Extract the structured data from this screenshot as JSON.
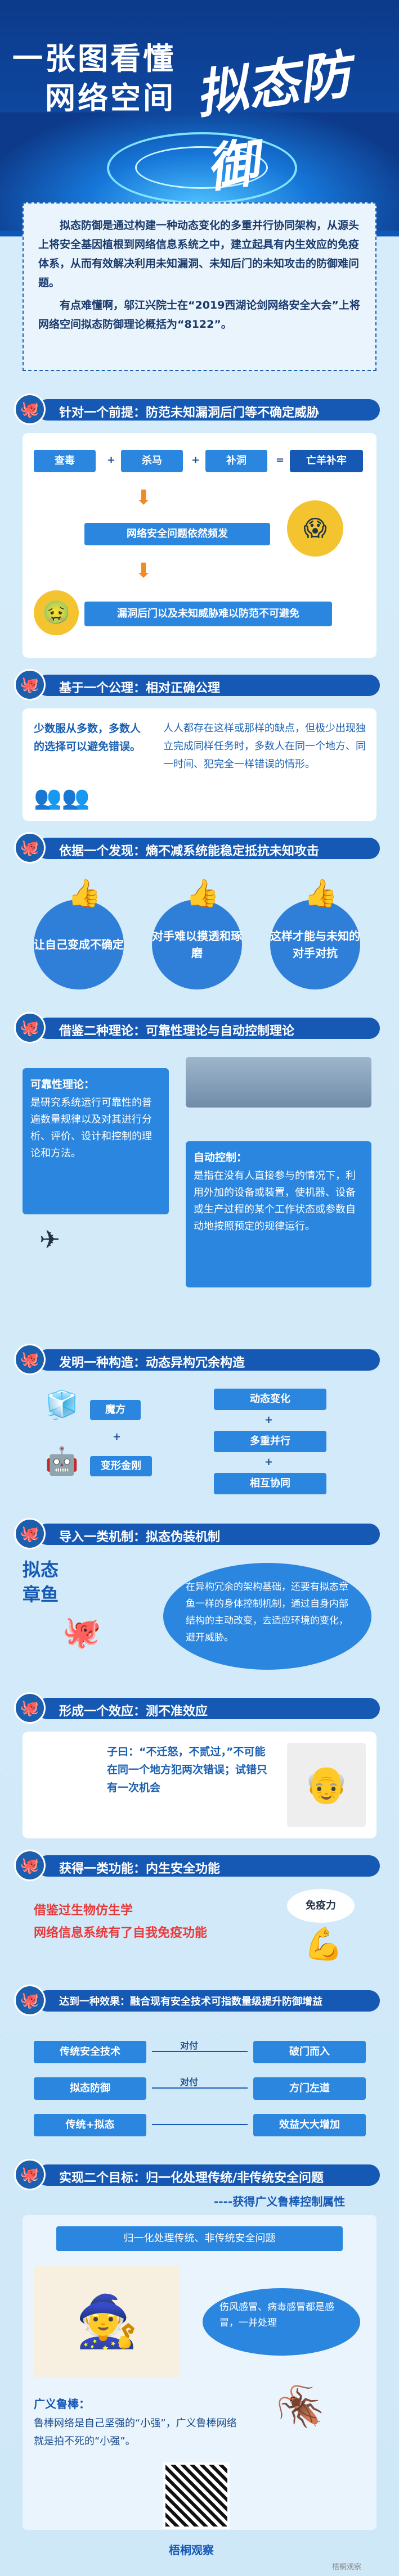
{
  "header": {
    "line1": "一张图看懂",
    "line2": "网络空间",
    "calligraphy": "拟态防御"
  },
  "intro": {
    "p1": "拟态防御是通过构建一种动态变化的多重并行协同架构，从源头上将安全基因植根到网络信息系统之中，建立起具有内生效应的免疫体系，从而有效解决利用未知漏洞、未知后门的未知攻击的防御难问题。",
    "p2": "有点难懂啊，邬江兴院士在“2019西湖论剑网络安全大会”上将网络空间拟态防御理论概括为“8122”。"
  },
  "sections": [
    {
      "title": "针对一个前提：防范未知漏洞后门等不确定威胁"
    },
    {
      "title": "基于一个公理：相对正确公理"
    },
    {
      "title": "依据一个发现：熵不减系统能稳定抵抗未知攻击"
    },
    {
      "title": "借鉴二种理论：可靠性理论与自动控制理论"
    },
    {
      "title": "发明一种构造：动态异构冗余构造"
    },
    {
      "title": "导入一类机制：拟态伪装机制"
    },
    {
      "title": "形成一个效应：测不准效应"
    },
    {
      "title": "获得一类功能：内生安全功能"
    },
    {
      "title": "达到一种效果：融合现有安全技术可指数量级提升防御增益"
    },
    {
      "title": "实现二个目标：归一化处理传统/非传统安全问题"
    }
  ],
  "s1": {
    "a": "查毒",
    "b": "杀马",
    "c": "补洞",
    "result": "亡羊补牢",
    "mid": "网络安全问题依然频发",
    "bottom": "漏洞后门以及未知威胁难以防范不可避免"
  },
  "s2": {
    "left": "少数服从多数，多数人的选择可以避免错误。",
    "right": "人人都存在这样或那样的缺点，但极少出现独立完成同样任务时，多数人在同一个地方、同一时间、犯完全一样错误的情形。"
  },
  "s3": {
    "b1": "让自己变成不确定",
    "b2": "对手难以摸透和琢磨",
    "b3": "这样才能与未知的对手对抗"
  },
  "s4": {
    "rel_title": "可靠性理论：",
    "rel_text": "是研究系统运行可靠性的普遍数量规律以及对其进行分析、评价、设计和控制的理论和方法。",
    "ctl_title": "自动控制：",
    "ctl_text": "是指在没有人直接参与的情况下，利用外加的设备或装置，使机器、设备或生产过程的某个工作状态或参数自动地按照预定的规律运行。"
  },
  "s5": {
    "c1": "魔方",
    "c2": "变形金刚",
    "r1": "动态变化",
    "r2": "多重并行",
    "r3": "相互协同",
    "plus": "+"
  },
  "s6": {
    "side": "拟态章鱼",
    "text": "在异构冗余的架构基础，还要有拟态章鱼一样的身体控制机制，通过自身内部结构的主动改变，去适应环境的变化，避开威胁。"
  },
  "s7": {
    "quote": "子曰：“不迁怒，不贰过，”不可能在同一个地方犯两次错误；试错只有一次机会"
  },
  "s8": {
    "text1": "借鉴过生物仿生学",
    "text2": "网络信息系统有了自我免疫功能",
    "bubble": "免疫力"
  },
  "s9": {
    "rows": [
      {
        "a": "传统安全技术",
        "b": "破门而入",
        "mid": "对付"
      },
      {
        "a": "拟态防御",
        "b": "方门左道",
        "mid": "对付"
      },
      {
        "a": "传统+拟态",
        "b": "效益大大增加",
        "mid": ""
      }
    ]
  },
  "s10": {
    "subtitle": "----获得广义鲁棒控制属性",
    "box": "归一化处理传统、非传统安全问题",
    "bubble": "伤风感冒、病毒感冒都是感冒，一并处理",
    "broad_title": "广义鲁棒：",
    "broad_text": "鲁棒网络是自己坚强的“小强”，广义鲁棒网络就是拍不死的“小强”。"
  },
  "footer": {
    "brand": "梧桐观察",
    "watermark": "梧桐观察"
  },
  "colors": {
    "primary": "#1659b5",
    "accent": "#e83a3a",
    "bg": "#cfe8f8"
  }
}
